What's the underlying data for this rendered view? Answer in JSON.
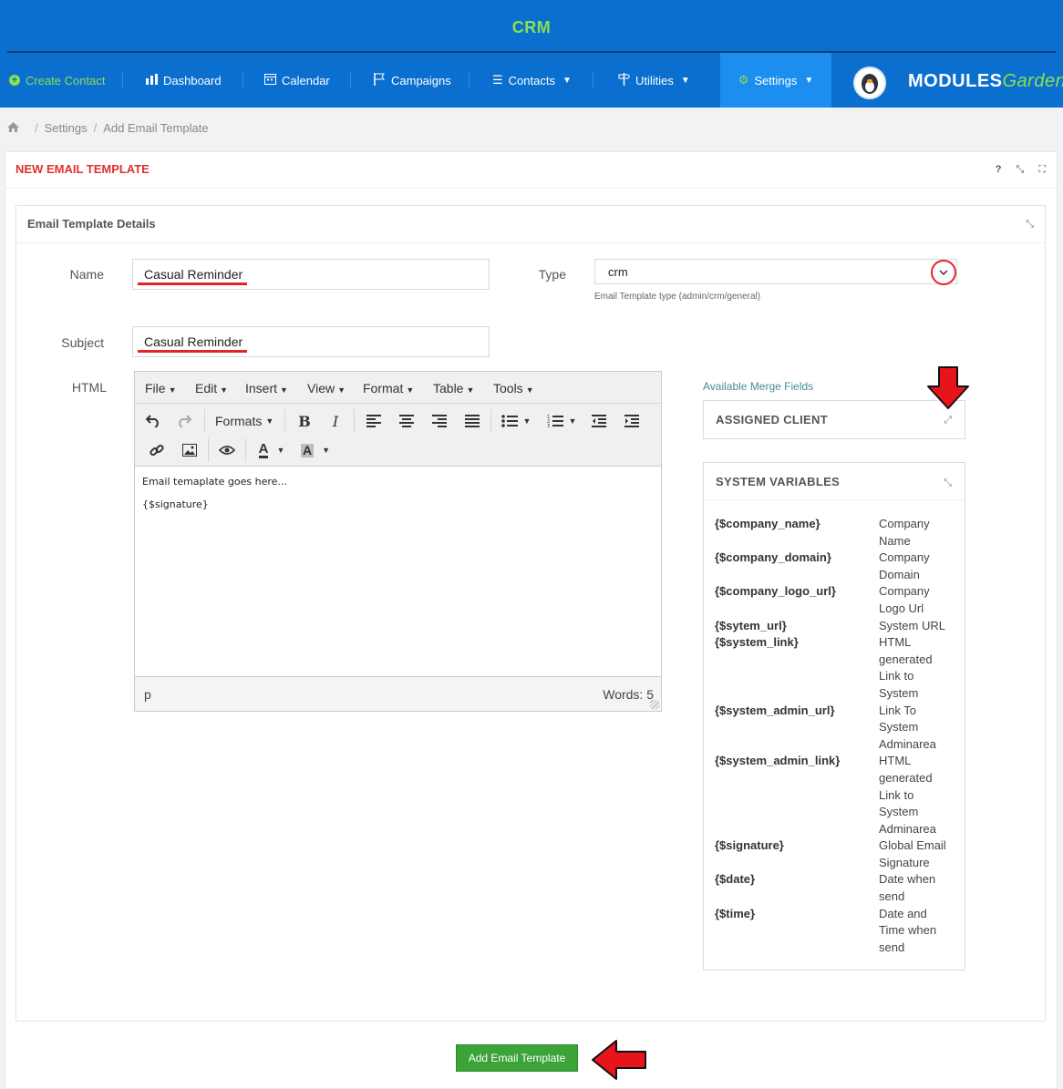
{
  "app": {
    "title": "CRM"
  },
  "nav": {
    "create_contact": "Create Contact",
    "dashboard": "Dashboard",
    "calendar": "Calendar",
    "campaigns": "Campaigns",
    "contacts": "Contacts",
    "utilities": "Utilities",
    "settings": "Settings",
    "logo_main": "MODULES",
    "logo_sub": "Garden"
  },
  "breadcrumb": {
    "items": [
      "Settings",
      "Add Email Template"
    ]
  },
  "portlet": {
    "title": "NEW EMAIL TEMPLATE",
    "tools": [
      "?",
      "⤡",
      "⛶"
    ]
  },
  "details": {
    "title": "Email Template Details",
    "name_label": "Name",
    "name_value": "Casual Reminder",
    "type_label": "Type",
    "type_value": "crm",
    "type_help": "Email Template type (admin/crm/general)",
    "subject_label": "Subject",
    "subject_value": "Casual Reminder",
    "html_label": "HTML"
  },
  "editor": {
    "menus": [
      "File",
      "Edit",
      "Insert",
      "View",
      "Format",
      "Table",
      "Tools"
    ],
    "formats_label": "Formats",
    "content_lines": [
      "Email temaplate goes here...",
      "{$signature}"
    ],
    "status_path": "p",
    "word_count": "Words: 5"
  },
  "merge_fields": {
    "heading": "Available Merge Fields",
    "assigned_client": "ASSIGNED CLIENT",
    "system_variables": "SYSTEM VARIABLES",
    "variables": [
      {
        "key": "{$company_name}",
        "desc": "Company Name"
      },
      {
        "key": "{$company_domain}",
        "desc": "Company Domain"
      },
      {
        "key": "{$company_logo_url}",
        "desc": "Company Logo Url"
      },
      {
        "key": "{$sytem_url}",
        "desc": "System URL"
      },
      {
        "key": "{$system_link}",
        "desc": "HTML generated Link to System"
      },
      {
        "key": "{$system_admin_url}",
        "desc": "Link To System Adminarea"
      },
      {
        "key": "{$system_admin_link}",
        "desc": "HTML generated Link to System Adminarea"
      },
      {
        "key": "{$signature}",
        "desc": "Global Email Signature"
      },
      {
        "key": "{$date}",
        "desc": "Date when send"
      },
      {
        "key": "{$time}",
        "desc": "Date and Time when send"
      }
    ]
  },
  "actions": {
    "submit": "Add Email Template"
  },
  "colors": {
    "header": "#0b6fd0",
    "accent_green": "#8be04e",
    "title_red": "#e0312f",
    "button_green": "#3ba338"
  }
}
